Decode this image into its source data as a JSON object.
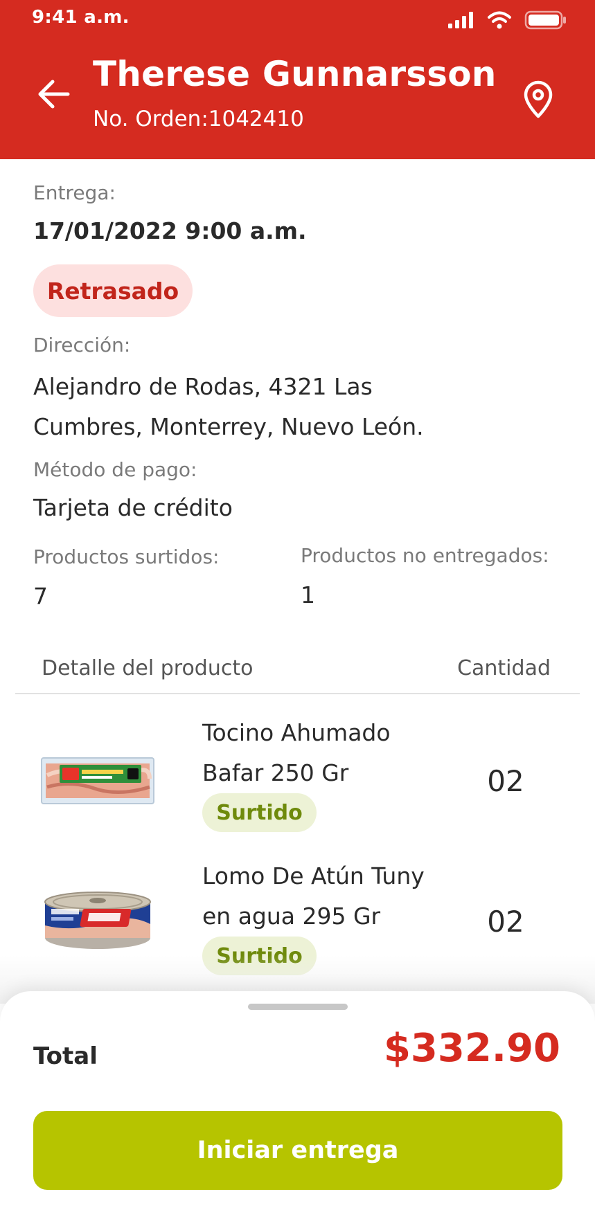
{
  "status_bar": {
    "time": "9:41 a.m."
  },
  "header": {
    "customer_name": "Therese Gunnarsson",
    "order_label": "No. Orden:",
    "order_number": "1042410"
  },
  "delivery": {
    "label": "Entrega:",
    "datetime": "17/01/2022 9:00 a.m.",
    "status": "Retrasado"
  },
  "address": {
    "label": "Dirección:",
    "value": "Alejandro de Rodas, 4321 Las Cumbres, Monterrey, Nuevo León."
  },
  "payment": {
    "label": "Método de pago:",
    "value": "Tarjeta de crédito"
  },
  "summary": {
    "supplied_label": "Productos surtidos:",
    "supplied_value": "7",
    "not_delivered_label": "Productos no entregados:",
    "not_delivered_value": "1"
  },
  "products_table": {
    "header_detail": "Detalle del producto",
    "header_quantity": "Cantidad",
    "rows": [
      {
        "name": "Tocino Ahumado Bafar 250 Gr",
        "quantity": "02",
        "status": "Surtido"
      },
      {
        "name": "Lomo De Atún Tuny en agua 295 Gr",
        "quantity": "02",
        "status": "Surtido"
      }
    ]
  },
  "bottom_sheet": {
    "total_label": "Total",
    "total_value": "$332.90",
    "button_label": "Iniciar entrega"
  },
  "colors": {
    "brand_red": "#d52b20",
    "status_delayed_bg": "#fde0df",
    "status_delayed_text": "#c1251b",
    "supplied_bg": "#edf2d6",
    "supplied_text": "#6f8a0c",
    "primary_button": "#b6c400"
  },
  "icons": {
    "back": "arrow-left-icon",
    "location": "map-pin-icon",
    "signal": "cellular-signal-icon",
    "wifi": "wifi-icon",
    "battery": "battery-icon"
  }
}
